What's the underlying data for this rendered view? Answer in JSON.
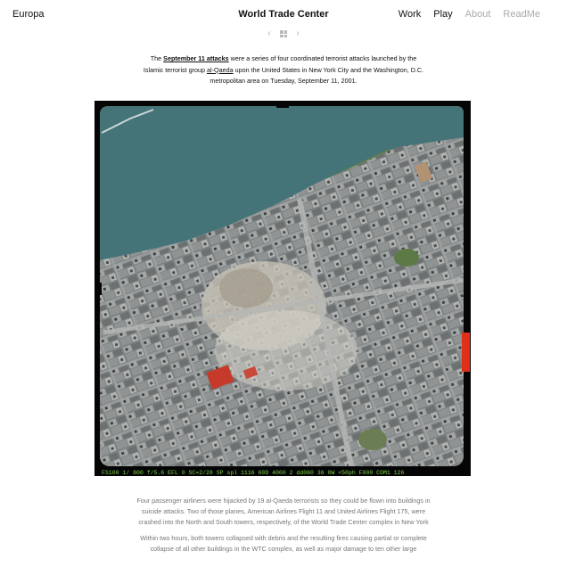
{
  "header": {
    "brand": "Europa",
    "title": "World Trade Center",
    "nav": [
      {
        "label": "Work",
        "state": "active"
      },
      {
        "label": "Play",
        "state": "active"
      },
      {
        "label": "About",
        "state": "muted"
      },
      {
        "label": "ReadMe",
        "state": "muted"
      }
    ]
  },
  "pager": {
    "prev_icon": "chevron-left-icon",
    "grid_icon": "grid-icon",
    "next_icon": "chevron-right-icon",
    "prev_glyph": "‹",
    "next_glyph": "›"
  },
  "intro": {
    "prefix": "The ",
    "link1": "September 11 attacks",
    "mid1": " were a series of four coordinated terrorist attacks launched by the Islamic terrorist group ",
    "link2": "al-Qaeda",
    "mid2": " upon the United States in New York City and the Washington, D.C. metropolitan area on Tuesday, September 11, 2001."
  },
  "photo": {
    "subject": "aerial photograph of Lower Manhattan",
    "edge_text": "FS100  1/ 800  f/5.6   EFL 0  SC=2/28 SP  spl 1116  60D 4000 2  dd060 36 0W <50ph F000 COM1 126"
  },
  "body": {
    "paragraph1": "Four passenger airliners were hijacked by 19 al-Qaeda terrorists so they could be flown into buildings in suicide attacks. Two of those planes, American Airlines Flight 11 and United Airlines Flight 175, were crashed into the North and South towers, respectively, of the World Trade Center complex in New York",
    "paragraph2": "Within two hours, both towers collapsed with debris and the resulting fires causing partial or complete collapse of all other buildings in the WTC complex, as well as major damage to ten other large"
  },
  "colors": {
    "film_border": "#050505",
    "water": "#3f6f73",
    "edge_text": "#7fd64a",
    "red_marker": "#e0301a",
    "muted_text": "#777777",
    "nav_muted": "#aaaaaa"
  }
}
